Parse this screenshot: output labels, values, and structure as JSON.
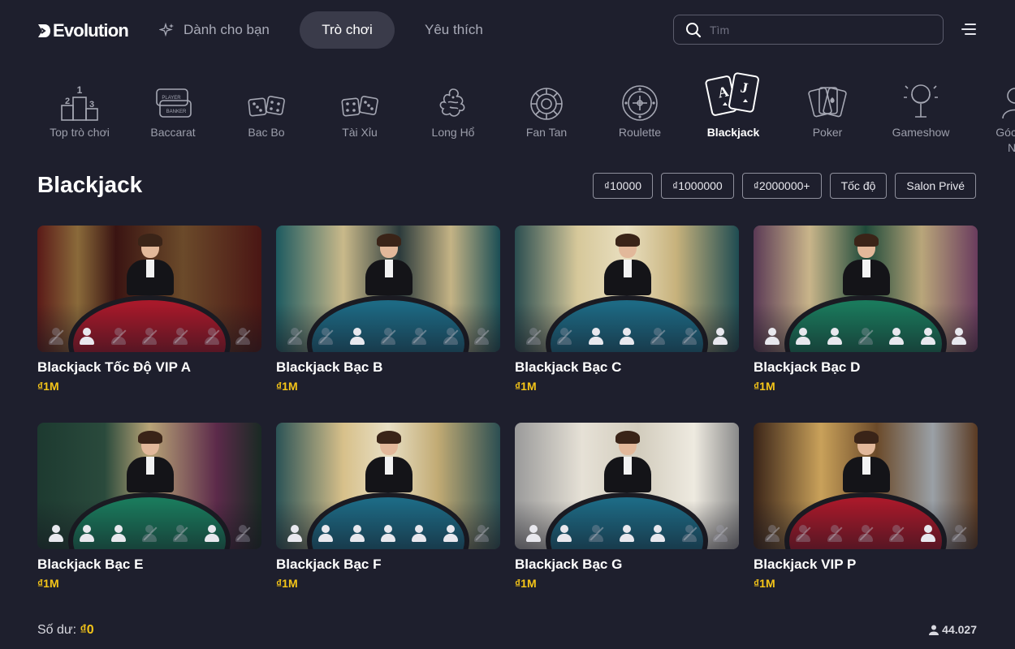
{
  "header": {
    "logo_text": "Evolution",
    "nav": {
      "for_you": "Dành cho bạn",
      "games": "Trò chơi",
      "favorites": "Yêu thích"
    },
    "search_placeholder": "Tìm"
  },
  "categories": [
    {
      "label": "Top trò chơi",
      "icon": "podium-icon"
    },
    {
      "label": "Baccarat",
      "icon": "baccarat-icon"
    },
    {
      "label": "Bac Bo",
      "icon": "dice-icon"
    },
    {
      "label": "Tài Xỉu",
      "icon": "dice-icon"
    },
    {
      "label": "Long Hổ",
      "icon": "dragon-icon"
    },
    {
      "label": "Fan Tan",
      "icon": "fan-tan-chip-icon"
    },
    {
      "label": "Roulette",
      "icon": "roulette-wheel-icon"
    },
    {
      "label": "Blackjack",
      "icon": "playing-cards-icon",
      "active": true
    },
    {
      "label": "Poker",
      "icon": "poker-cards-icon"
    },
    {
      "label": "Gameshow",
      "icon": "microphone-icon"
    },
    {
      "label": "Góc Nh",
      "label_line2": "Nh",
      "icon": "dealer-icon"
    }
  ],
  "section": {
    "title": "Blackjack",
    "filters": [
      "₫10000",
      "₫1000000",
      "₫2000000+",
      "Tốc độ",
      "Salon Privé"
    ]
  },
  "games": [
    {
      "title": "Blackjack Tốc Độ VIP A",
      "price": "₫1M",
      "felt": "red",
      "seats": [
        0,
        1,
        0,
        0,
        0,
        0,
        0
      ]
    },
    {
      "title": "Blackjack Bạc B",
      "price": "₫1M",
      "felt": "blue",
      "seats": [
        0,
        0,
        1,
        0,
        0,
        0,
        0
      ]
    },
    {
      "title": "Blackjack Bạc C",
      "price": "₫1M",
      "felt": "blue",
      "seats": [
        0,
        0,
        1,
        1,
        0,
        0,
        1
      ]
    },
    {
      "title": "Blackjack Bạc D",
      "price": "₫1M",
      "felt": "green",
      "seats": [
        1,
        1,
        1,
        0,
        1,
        1,
        1
      ]
    },
    {
      "title": "Blackjack Bạc E",
      "price": "₫1M",
      "felt": "green",
      "seats": [
        1,
        1,
        1,
        0,
        0,
        1,
        0
      ]
    },
    {
      "title": "Blackjack Bạc F",
      "price": "₫1M",
      "felt": "blue",
      "seats": [
        1,
        1,
        1,
        1,
        1,
        1,
        0
      ]
    },
    {
      "title": "Blackjack Bạc G",
      "price": "₫1M",
      "felt": "blue",
      "seats": [
        1,
        1,
        0,
        1,
        1,
        0,
        0
      ]
    },
    {
      "title": "Blackjack VIP P",
      "price": "₫1M",
      "felt": "red",
      "seats": [
        0,
        0,
        0,
        0,
        0,
        1,
        0
      ]
    }
  ],
  "footer": {
    "balance_label": "Số dư:",
    "balance_value": "₫0",
    "players_count": "44.027"
  },
  "colors": {
    "background": "#1e1f2d",
    "accent_gold": "#f5c518",
    "felt_red": "#a8192a",
    "felt_blue": "#1d6a84",
    "felt_green": "#1a7a5c"
  }
}
